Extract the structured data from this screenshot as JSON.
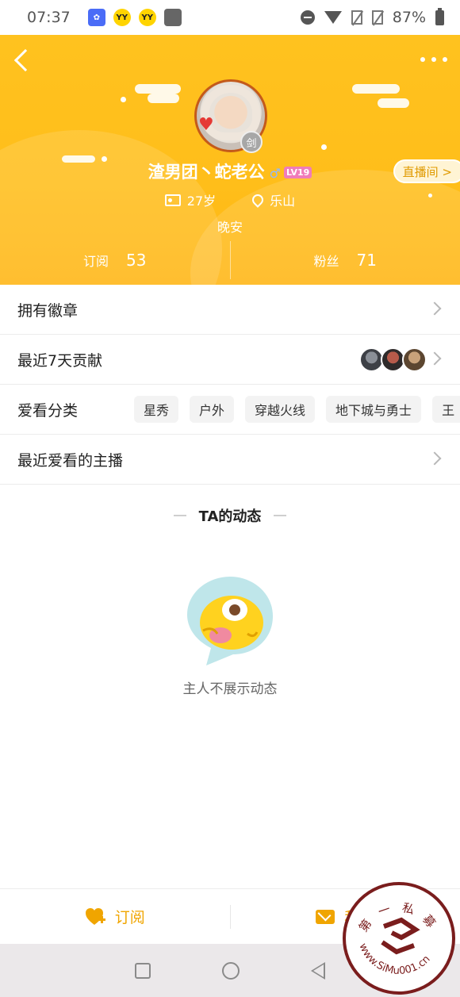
{
  "status_bar": {
    "time": "07:37",
    "battery": "87%",
    "app_icons": [
      "flower-app-icon",
      "yy-icon",
      "yy-icon",
      "image-icon"
    ]
  },
  "header": {
    "username": "渣男团丶蛇老公",
    "gender_symbol": "♂",
    "level": "LV19",
    "live_button_label": "直播间 >",
    "age": "27岁",
    "location": "乐山",
    "signature": "晚安",
    "badge_text": "剑",
    "stats": [
      {
        "label": "订阅",
        "count": "53"
      },
      {
        "label": "粉丝",
        "count": "71"
      }
    ],
    "colors": {
      "primary": "#FFC21F",
      "live_text": "#E09A00"
    }
  },
  "list": {
    "badges_label": "拥有徽章",
    "contributions_label": "最近7天贡献",
    "categories_label": "爱看分类",
    "category_tags": [
      "星秀",
      "户外",
      "穿越火线",
      "地下城与勇士",
      "王"
    ],
    "recent_anchors_label": "最近爱看的主播"
  },
  "feed": {
    "title": "TA的动态",
    "empty_text": "主人不展示动态"
  },
  "action_bar": {
    "subscribe_label": "订阅",
    "message_label": "私信",
    "accent_color": "#F0A500"
  },
  "watermark": {
    "top_text": "第 一 私 募",
    "url_text": "www.SiMu001.cn"
  }
}
